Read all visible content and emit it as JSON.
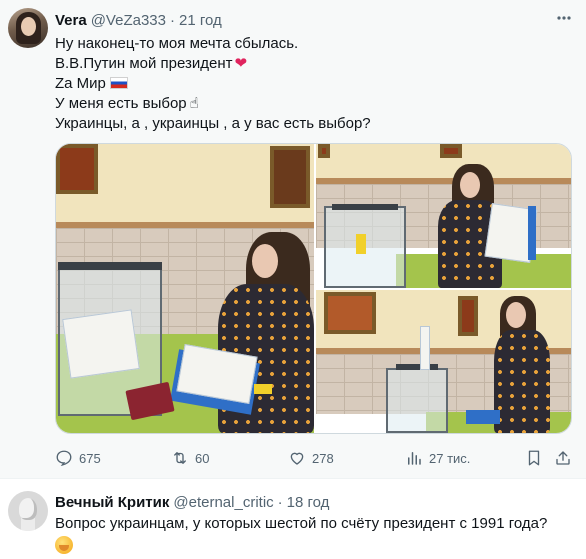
{
  "tweet": {
    "author_name": "Vera",
    "author_handle": "@VeZa333",
    "separator": "·",
    "time": "21 год",
    "more_icon": "more-dots-icon",
    "lines": [
      "Ну наконец-то моя мечта сбылась.",
      "В.В.Путин мой президент",
      "Za Мир",
      "У меня есть выбор",
      "Украинцы, а , украинцы , а у вас есть выбор?"
    ],
    "line_emojis": [
      "heart-icon",
      "ru-flag-icon",
      "raised-finger-icon"
    ],
    "heart_glyph": "❤",
    "hand_glyph": "☝",
    "actions": {
      "reply_count": "675",
      "retweet_count": "60",
      "like_count": "278",
      "views_count": "27 тис."
    },
    "colors": {
      "secondary_text": "#536471",
      "heart": "#e0245e",
      "background": "#f7f9f9"
    }
  },
  "reply": {
    "author_name": "Вечный Критик",
    "author_handle": "@eternal_critic",
    "separator": "·",
    "time": "18 год",
    "text": "Вопрос украинцам, у которых шестой по счёту президент с 1991 года?",
    "emoji": "hand-over-mouth-icon"
  }
}
